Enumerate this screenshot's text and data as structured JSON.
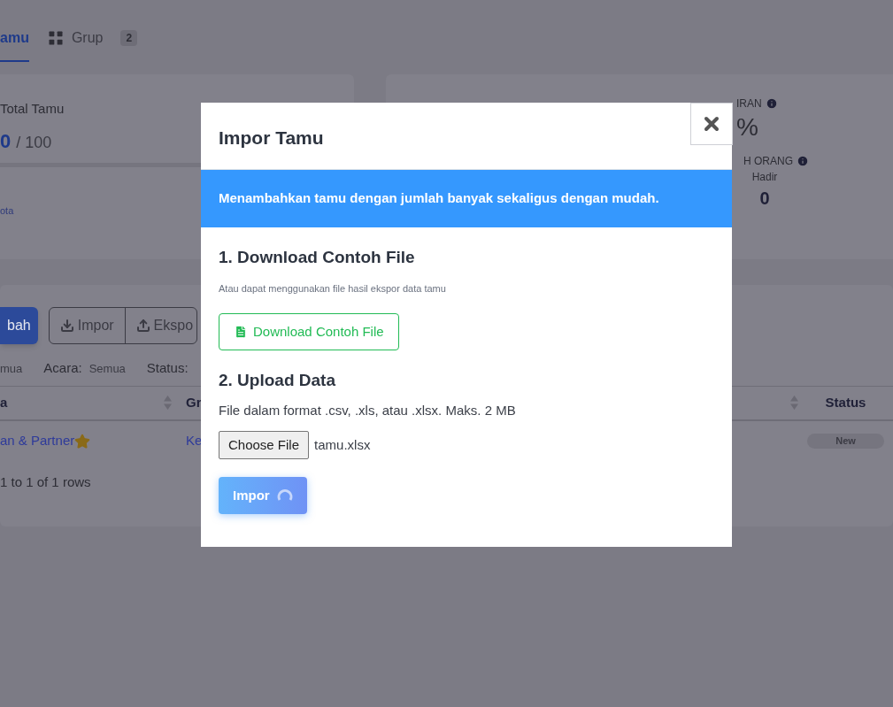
{
  "background": {
    "tabs": [
      {
        "label": "amu",
        "selected": true
      },
      {
        "label": "Grup",
        "badge": "2",
        "selected": false
      }
    ],
    "quota_card": {
      "title": "Total Tamu",
      "count": "0",
      "total": "/ 100",
      "link": "ota"
    },
    "attendance_card": {
      "heading": "IRAN",
      "percent": "%",
      "people_heading": "H ORANG",
      "present_label": "Hadir",
      "present_value": "0"
    },
    "toolbar": {
      "add_button": "bah",
      "import_button": "Impor",
      "export_button": "Ekspo"
    },
    "filters": [
      {
        "value": "mua"
      },
      {
        "label": "Acara:",
        "value": "Semua"
      },
      {
        "label": "Status:"
      }
    ],
    "table": {
      "columns": [
        {
          "label": "a",
          "sortable": true
        },
        {
          "label": "Gr"
        },
        {
          "sortable": true
        },
        {
          "label": "Status"
        }
      ],
      "rows": [
        {
          "name": "an & Partner",
          "starred": true,
          "group": "Ke",
          "status": "New"
        }
      ]
    },
    "footer": "1 to 1 of 1 rows"
  },
  "modal": {
    "title": "Impor Tamu",
    "info": "Menambahkan tamu dengan jumlah banyak sekaligus dengan mudah.",
    "step1_title": "1. Download Contoh File",
    "step1_hint": "Atau dapat menggunakan file hasil ekspor data tamu",
    "download_button": "Download Contoh File",
    "step2_title": "2. Upload Data",
    "step2_hint": "File dalam format .csv, .xls, atau .xlsx. Maks. 2 MB",
    "file_button": "Choose File",
    "file_name": "tamu.xlsx",
    "submit_button": "Impor",
    "loading": true
  }
}
